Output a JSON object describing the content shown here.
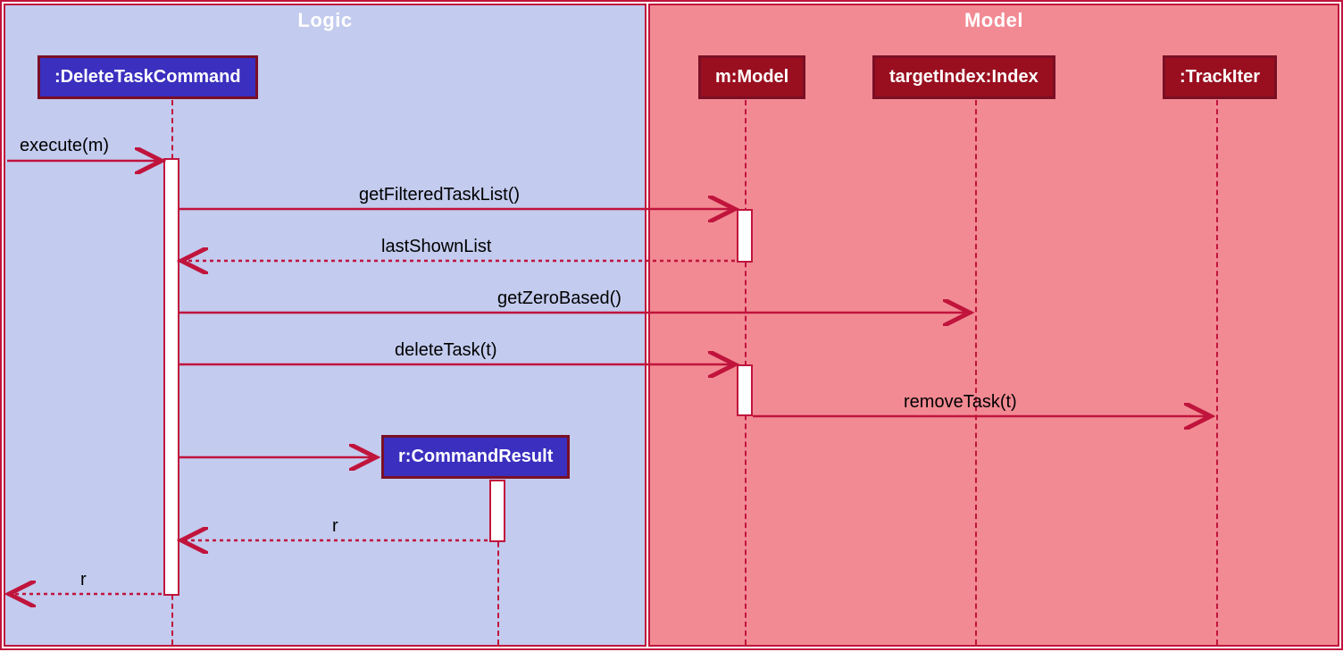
{
  "regions": {
    "logic": {
      "title": "Logic"
    },
    "model": {
      "title": "Model"
    }
  },
  "participants": {
    "deleteTaskCommand": {
      "label": ":DeleteTaskCommand"
    },
    "model": {
      "label": "m:Model"
    },
    "targetIndex": {
      "label": "targetIndex:Index"
    },
    "trackIter": {
      "label": ":TrackIter"
    },
    "commandResult": {
      "label": "r:CommandResult"
    }
  },
  "messages": {
    "execute": "execute(m)",
    "getFilteredTaskList": "getFilteredTaskList()",
    "lastShownList": "lastShownList",
    "getZeroBased": "getZeroBased()",
    "deleteTask": "deleteTask(t)",
    "removeTask": "removeTask(t)",
    "returnR1": "r",
    "returnR2": "r"
  }
}
